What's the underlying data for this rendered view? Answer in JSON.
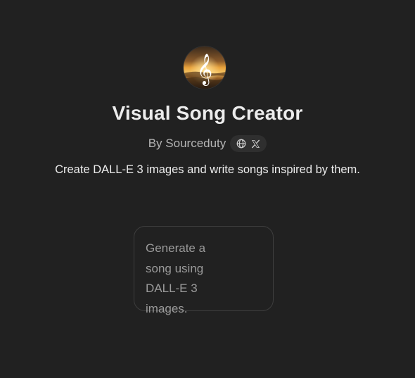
{
  "gpt": {
    "title": "Visual Song Creator",
    "byline": "By Sourceduty",
    "description": "Create DALL-E 3 images and write songs inspired by them."
  },
  "social": {
    "icons": [
      "globe-icon",
      "x-logo-icon"
    ]
  },
  "conversation_starters": [
    {
      "text": "Generate a song using DALL-E 3 images."
    }
  ],
  "colors": {
    "background": "#212121",
    "title": "#ececec",
    "byline": "#b4b4b4",
    "pill_background": "#2f2f2f",
    "starter_border": "#3e3e3e",
    "starter_text": "#9b9b9b"
  }
}
